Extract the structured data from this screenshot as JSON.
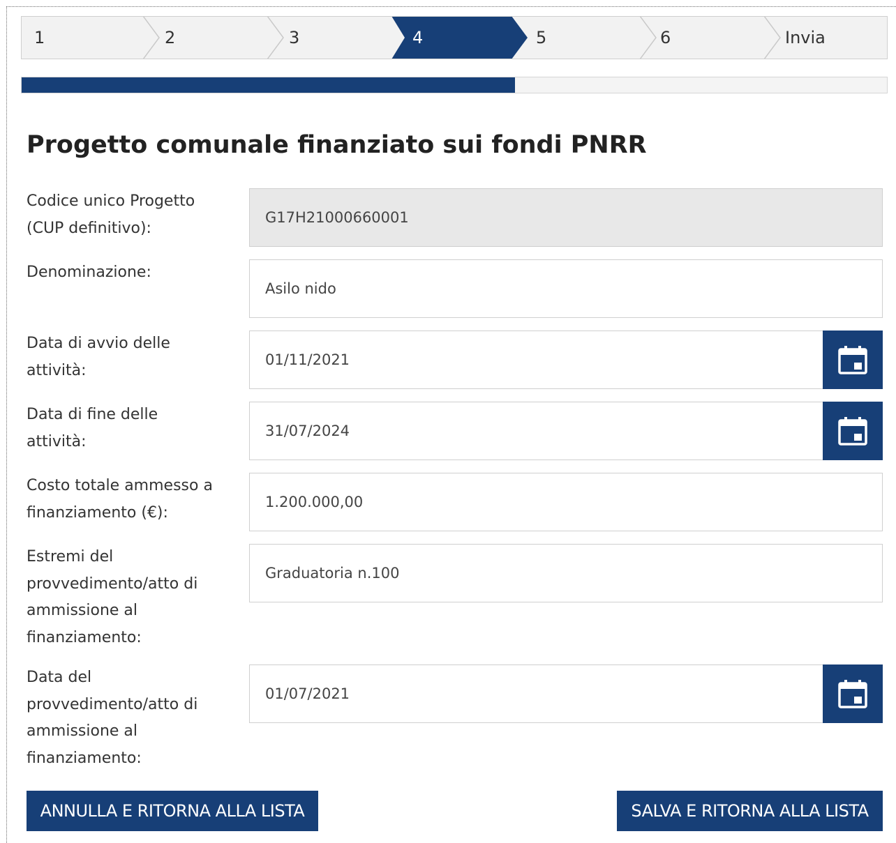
{
  "stepper": {
    "steps": [
      "1",
      "2",
      "3",
      "4",
      "5",
      "6",
      "Invia"
    ],
    "active_index": 3
  },
  "progress": {
    "fraction": 0.57
  },
  "page": {
    "title": "Progetto comunale finanziato sui fondi PNRR"
  },
  "form": {
    "fields": [
      {
        "label": "Codice unico Progetto (CUP definitivo):",
        "value": "G17H21000660001",
        "readonly": true,
        "calendar": false
      },
      {
        "label": "Denominazione:",
        "value": "Asilo nido",
        "readonly": false,
        "calendar": false
      },
      {
        "label": "Data di avvio delle attività:",
        "value": "01/11/2021",
        "readonly": false,
        "calendar": true
      },
      {
        "label": "Data di fine delle attività:",
        "value": "31/07/2024",
        "readonly": false,
        "calendar": true
      },
      {
        "label": "Costo totale ammesso a finanziamento (€):",
        "value": "1.200.000,00",
        "readonly": false,
        "calendar": false
      },
      {
        "label": "Estremi del provvedimento/atto di ammissione al finanziamento:",
        "value": "Graduatoria n.100",
        "readonly": false,
        "calendar": false
      },
      {
        "label": "Data del provvedimento/atto di ammissione al finanziamento:",
        "value": "01/07/2021",
        "readonly": false,
        "calendar": true
      }
    ]
  },
  "actions": {
    "cancel_label": "ANNULLA E RITORNA ALLA LISTA",
    "save_label": "SALVA E RITORNA ALLA LISTA"
  },
  "icons": {
    "calendar": "calendar-icon"
  },
  "colors": {
    "primary": "#173f77",
    "readonly_bg": "#e8e8e8",
    "stepper_bg": "#f2f2f2"
  }
}
